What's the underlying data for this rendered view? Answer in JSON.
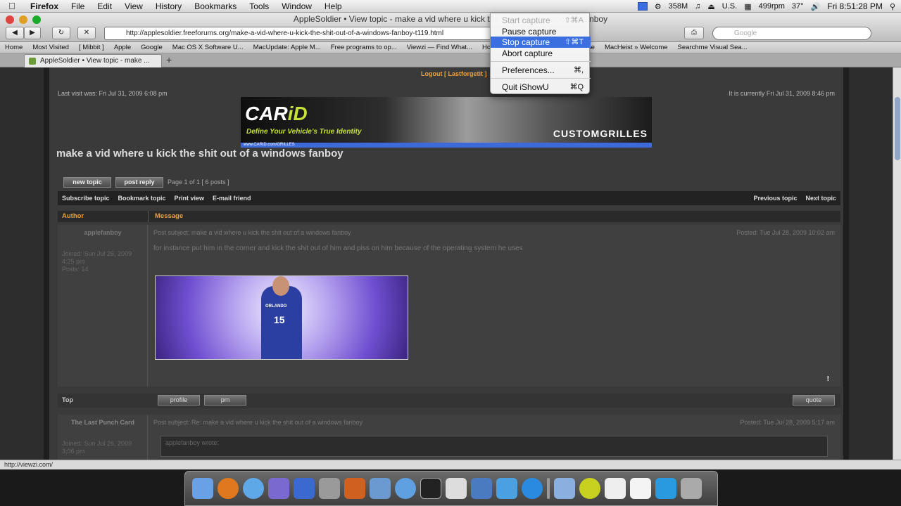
{
  "menubar": {
    "apple_icon": "apple-icon",
    "items": [
      "Firefox",
      "File",
      "Edit",
      "View",
      "History",
      "Bookmarks",
      "Tools",
      "Window",
      "Help"
    ],
    "memory": "358M",
    "rpm": "499rpm",
    "temp": "37°",
    "region": "U.S.",
    "clock": "Fri 8:51:28 PM"
  },
  "window": {
    "title": "AppleSoldier • View topic - make a vid where u kick the shit out of a windows fanboy"
  },
  "toolbar": {
    "url": "http://applesoldier.freeforums.org/make-a-vid-where-u-kick-the-shit-out-of-a-windows-fanboy-t119.html",
    "search_placeholder": "Google"
  },
  "bookmarks": [
    "Home",
    "Most Visited",
    "[ Mibbit ]",
    "Apple",
    "Google",
    "Mac OS X Software U...",
    "MacUpdate: Apple M...",
    "Free programs to op...",
    "Viewzi — Find What...",
    "Home Page - Televis...",
    "QTYouTube",
    "MacHeist » Welcome",
    "Searchme Visual Sea..."
  ],
  "tab": {
    "label": "AppleSoldier • View topic - make ..."
  },
  "forum": {
    "logout": "Logout [ Lastforgetit ]",
    "last_visit": "Last visit was: Fri Jul 31, 2009 6:08 pm",
    "current_time": "It is currently Fri Jul 31, 2009 8:46 pm",
    "banner": {
      "logo": "CAR",
      "logo_accent": "iD",
      "tagline": "Define Your Vehicle's True Identity",
      "product": "CUSTOMGRILLES",
      "strip": "www.CARiD.com/GRILLES"
    },
    "topic_title": "make a vid where u kick the shit out of a windows fanboy",
    "new_topic": "new topic",
    "post_reply": "post reply",
    "pagination": "Page 1 of 1   [ 6 posts ]",
    "actions": [
      "Subscribe topic",
      "Bookmark topic",
      "Print view",
      "E-mail friend"
    ],
    "nav": [
      "Previous topic",
      "Next topic"
    ],
    "col_author": "Author",
    "col_message": "Message",
    "posts": [
      {
        "author": "applefanboy",
        "subject": "Post subject: make a vid where u kick the shit out of a windows fanboy",
        "posted": "Posted: Tue Jul 28, 2009 10:02 am",
        "joined": "Joined: Sun Jul 26, 2009 4:25 pm",
        "posts": "Posts: 14",
        "body": "for instance put him in the corner and kick the shit out of him and piss on him because of the operating system he uses",
        "jersey": "15",
        "jersey_team": "ORLANDO"
      },
      {
        "author": "The Last Punch Card",
        "subject": "Post subject: Re: make a vid where u kick the shit out of a windows fanboy",
        "posted": "Posted: Tue Jul 28, 2009 5:17 am",
        "joined": "Joined: Sun Jul 26, 2009 3:06 pm",
        "quote_header": "applefanboy wrote:"
      }
    ],
    "top_link": "Top",
    "profile": "profile",
    "pm": "pm",
    "quote": "quote"
  },
  "status_bar": {
    "text": "http://viewzi.com/"
  },
  "dock_menu": {
    "items": [
      {
        "label": "Start capture",
        "shortcut": "⇧⌘A",
        "state": "disabled"
      },
      {
        "label": "Pause capture",
        "shortcut": "",
        "state": "normal"
      },
      {
        "label": "Stop capture",
        "shortcut": "⇧⌘T",
        "state": "selected"
      },
      {
        "label": "Abort capture",
        "shortcut": "",
        "state": "normal"
      },
      {
        "label": "Preferences...",
        "shortcut": "⌘,",
        "state": "normal"
      },
      {
        "label": "Quit iShowU",
        "shortcut": "⌘Q",
        "state": "normal"
      }
    ]
  },
  "colors": {
    "accent": "#3b6fe0",
    "forum_orange": "#e8a040",
    "brand_green": "#c6e23a"
  }
}
